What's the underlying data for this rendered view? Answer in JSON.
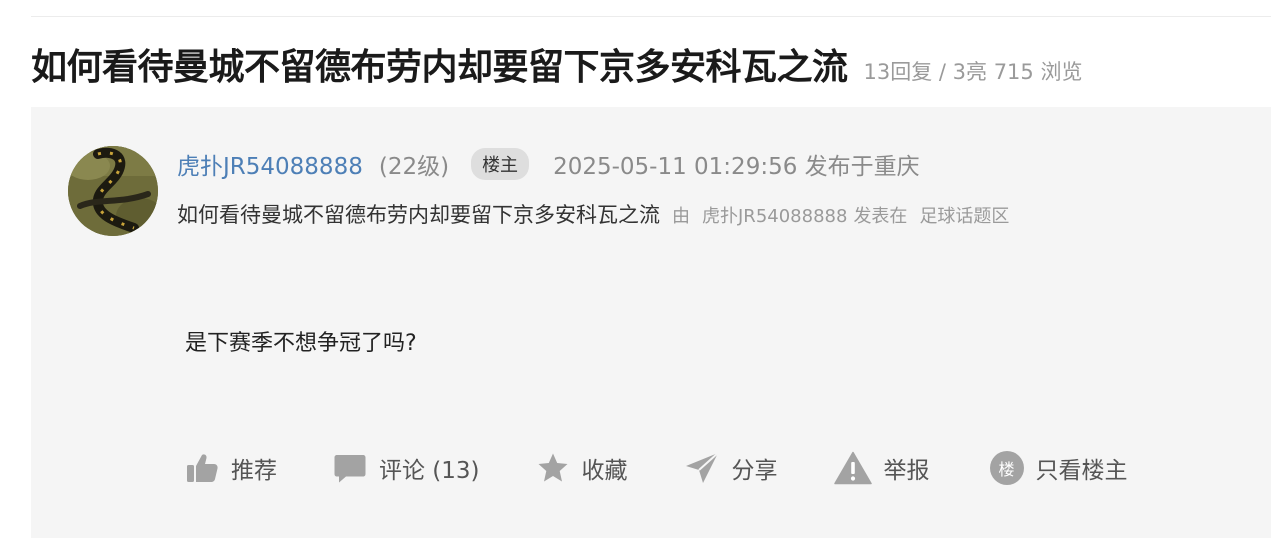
{
  "header": {
    "title": "如何看待曼城不留德布劳内却要留下京多安科瓦之流",
    "stats": "13回复 / 3亮 715 浏览"
  },
  "post": {
    "author": "虎扑JR54088888",
    "level": "(22级)",
    "op_badge": "楼主",
    "timestamp": "2025-05-11 01:29:56 发布于重庆",
    "subtitle": "如何看待曼城不留德布劳内却要留下京多安科瓦之流",
    "by_label": "由",
    "by_author": "虎扑JR54088888",
    "posted_in_label": "发表在",
    "board": "足球话题区",
    "content": "是下赛季不想争冠了吗?"
  },
  "actions": {
    "like_label": "推荐",
    "comment_label": "评论 (13)",
    "favorite_label": "收藏",
    "share_label": "分享",
    "report_label": "举报",
    "only_op_icon_text": "楼",
    "only_op_label": "只看楼主"
  },
  "colors": {
    "author_link": "#4d7fb6",
    "panel_bg": "#f5f5f5",
    "icon_gray": "#a3a3a3",
    "badge_bg": "#dedede"
  },
  "icons": {
    "like": "thumbs-up-icon",
    "comment": "comment-bubble-icon",
    "favorite": "star-icon",
    "share": "paper-plane-icon",
    "report": "warning-triangle-icon",
    "only_op": "op-circle-icon"
  }
}
